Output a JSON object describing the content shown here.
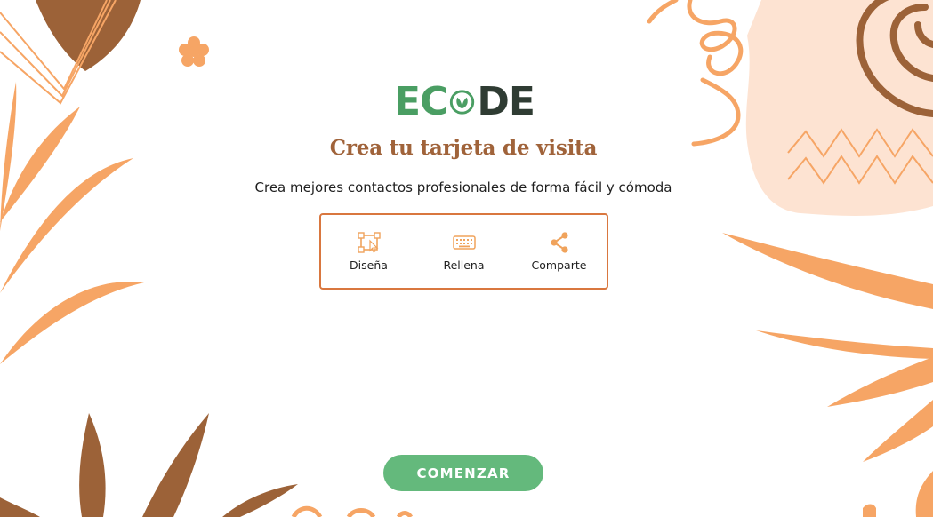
{
  "brand": {
    "logo_left": "EC",
    "logo_right": "DE",
    "logo_mark": "leaf-o-icon",
    "colors": {
      "green": "#4a9e63",
      "dark": "#2f3c33"
    }
  },
  "header": {
    "title": "Crea tu tarjeta de visita",
    "subtitle": "Crea mejores contactos profesionales de forma fácil y cómoda"
  },
  "steps": [
    {
      "label": "Diseña",
      "icon": "design-icon"
    },
    {
      "label": "Rellena",
      "icon": "keyboard-icon"
    },
    {
      "label": "Comparte",
      "icon": "share-icon"
    }
  ],
  "cta": {
    "label": "COMENZAR",
    "color": "#64b97c"
  },
  "theme": {
    "accent_orange": "#f6a565",
    "accent_brown": "#9c6238",
    "title_color": "#a0633a",
    "box_border": "#d9773f"
  }
}
